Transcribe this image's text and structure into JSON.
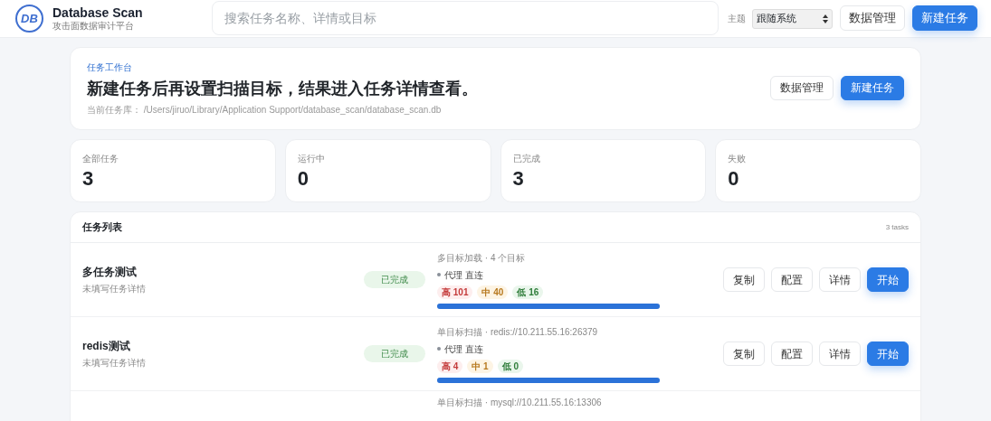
{
  "app": {
    "logo": "DB",
    "title": "Database Scan",
    "subtitle": "攻击面数据审计平台"
  },
  "search": {
    "placeholder": "搜索任务名称、详情或目标"
  },
  "theme": {
    "label": "主题",
    "value": "跟随系统"
  },
  "header_buttons": [
    {
      "label": "数据管理",
      "kind": "secondary"
    },
    {
      "label": "新建任务",
      "kind": "primary"
    }
  ],
  "hero": {
    "eyebrow": "任务工作台",
    "heading": "新建任务后再设置扫描目标，结果进入任务详情查看。",
    "db_label": "当前任务库：",
    "db_path": "/Users/jiruo/Library/Application Support/database_scan/database_scan.db",
    "buttons": [
      {
        "label": "数据管理",
        "kind": "secondary"
      },
      {
        "label": "新建任务",
        "kind": "primary"
      }
    ]
  },
  "stats": [
    {
      "label": "全部任务",
      "value": "3"
    },
    {
      "label": "运行中",
      "value": "0"
    },
    {
      "label": "已完成",
      "value": "3"
    },
    {
      "label": "失败",
      "value": "0"
    }
  ],
  "task_list": {
    "title": "任务列表",
    "count": "3 tasks",
    "rows": [
      {
        "name": "多任务测试",
        "detail": "未填写任务详情",
        "status": "已完成",
        "target": "多目标加载 · 4 个目标",
        "proxy": "代理 直连",
        "severity": [
          {
            "label": "高 101",
            "kind": "high"
          },
          {
            "label": "中 40",
            "kind": "medium"
          },
          {
            "label": "低 16",
            "kind": "low"
          }
        ],
        "level": 1,
        "actions": [
          {
            "label": "复制",
            "kind": "secondary"
          },
          {
            "label": "配置",
            "kind": "secondary"
          },
          {
            "label": "详情",
            "kind": "secondary"
          },
          {
            "label": "开始",
            "kind": "primary"
          }
        ]
      },
      {
        "name": "redis测试",
        "detail": "未填写任务详情",
        "status": "已完成",
        "target": "单目标扫描 · redis://10.211.55.16:26379",
        "proxy": "代理 直连",
        "severity": [
          {
            "label": "高 4",
            "kind": "high"
          },
          {
            "label": "中 1",
            "kind": "medium"
          },
          {
            "label": "低 0",
            "kind": "low"
          }
        ],
        "level": 1,
        "actions": [
          {
            "label": "复制",
            "kind": "secondary"
          },
          {
            "label": "配置",
            "kind": "secondary"
          },
          {
            "label": "详情",
            "kind": "secondary"
          },
          {
            "label": "开始",
            "kind": "primary"
          }
        ]
      },
      {
        "target": "单目标扫描 · mysql://10.211.55.16:13306"
      }
    ]
  }
}
